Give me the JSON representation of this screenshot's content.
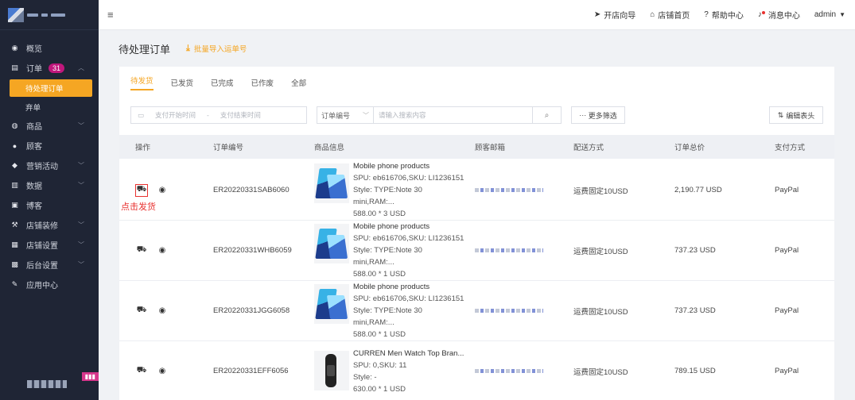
{
  "topbar": {
    "links": [
      {
        "icon": "send-icon",
        "label": "开店向导"
      },
      {
        "icon": "home-icon",
        "label": "店铺首页"
      },
      {
        "icon": "help-icon",
        "label": "帮助中心"
      },
      {
        "icon": "bell-icon",
        "label": "消息中心"
      }
    ],
    "user": "admin"
  },
  "sidebar": {
    "items": [
      {
        "icon": "gauge-icon",
        "label": "概览"
      },
      {
        "icon": "order-icon",
        "label": "订单",
        "badge": "31"
      },
      {
        "icon": "box-icon",
        "label": "商品"
      },
      {
        "icon": "user-icon",
        "label": "顾客"
      },
      {
        "icon": "tag-icon",
        "label": "营销活动"
      },
      {
        "icon": "chart-icon",
        "label": "数据"
      },
      {
        "icon": "blog-icon",
        "label": "博客"
      },
      {
        "icon": "brush-icon",
        "label": "店铺装修"
      },
      {
        "icon": "store-icon",
        "label": "店铺设置"
      },
      {
        "icon": "admin-icon",
        "label": "后台设置"
      },
      {
        "icon": "app-icon",
        "label": "应用中心"
      }
    ],
    "order_sub": [
      {
        "label": "待处理订单",
        "active": true
      },
      {
        "label": "弃单",
        "active": false
      }
    ]
  },
  "page": {
    "title": "待处理订单",
    "import_label": "批量导入运单号"
  },
  "tabs": [
    "待发货",
    "已发货",
    "已完成",
    "已作废",
    "全部"
  ],
  "filters": {
    "start_placeholder": "支付开始时间",
    "end_placeholder": "支付结束时间",
    "select_value": "订单编号",
    "search_placeholder": "请输入搜索内容",
    "more_label": "更多筛选",
    "edit_label": "编辑表头"
  },
  "table": {
    "headers": [
      "操作",
      "订单编号",
      "商品信息",
      "顾客邮箱",
      "配送方式",
      "订单总价",
      "支付方式"
    ],
    "hint": "点击发货",
    "rows": [
      {
        "order_no": "ER20220331SAB6060",
        "product": "Mobile phone products",
        "spu": "SPU: eb616706,SKU: LI1236151",
        "style": "Style: TYPE:Note 30 mini,RAM:...",
        "price": "588.00 * 3 USD",
        "shipping": "运费固定10USD",
        "total": "2,190.77 USD",
        "payment": "PayPal"
      },
      {
        "order_no": "ER20220331WHB6059",
        "product": "Mobile phone products",
        "spu": "SPU: eb616706,SKU: LI1236151",
        "style": "Style: TYPE:Note 30 mini,RAM:...",
        "price": "588.00 * 1 USD",
        "shipping": "运费固定10USD",
        "total": "737.23 USD",
        "payment": "PayPal"
      },
      {
        "order_no": "ER20220331JGG6058",
        "product": "Mobile phone products",
        "spu": "SPU: eb616706,SKU: LI1236151",
        "style": "Style: TYPE:Note 30 mini,RAM:...",
        "price": "588.00 * 1 USD",
        "shipping": "运费固定10USD",
        "total": "737.23 USD",
        "payment": "PayPal"
      },
      {
        "order_no": "ER20220331EFF6056",
        "product": "CURREN Men Watch Top Bran...",
        "spu": "SPU: 0,SKU: 11",
        "style": "Style: -",
        "price": "630.00 * 1 USD",
        "shipping": "运费固定10USD",
        "total": "789.15 USD",
        "payment": "PayPal"
      }
    ]
  },
  "colors": {
    "accent": "#f5a623",
    "sidebar": "#1f2535",
    "hint": "#e8312f",
    "badge": "#c0177c"
  }
}
